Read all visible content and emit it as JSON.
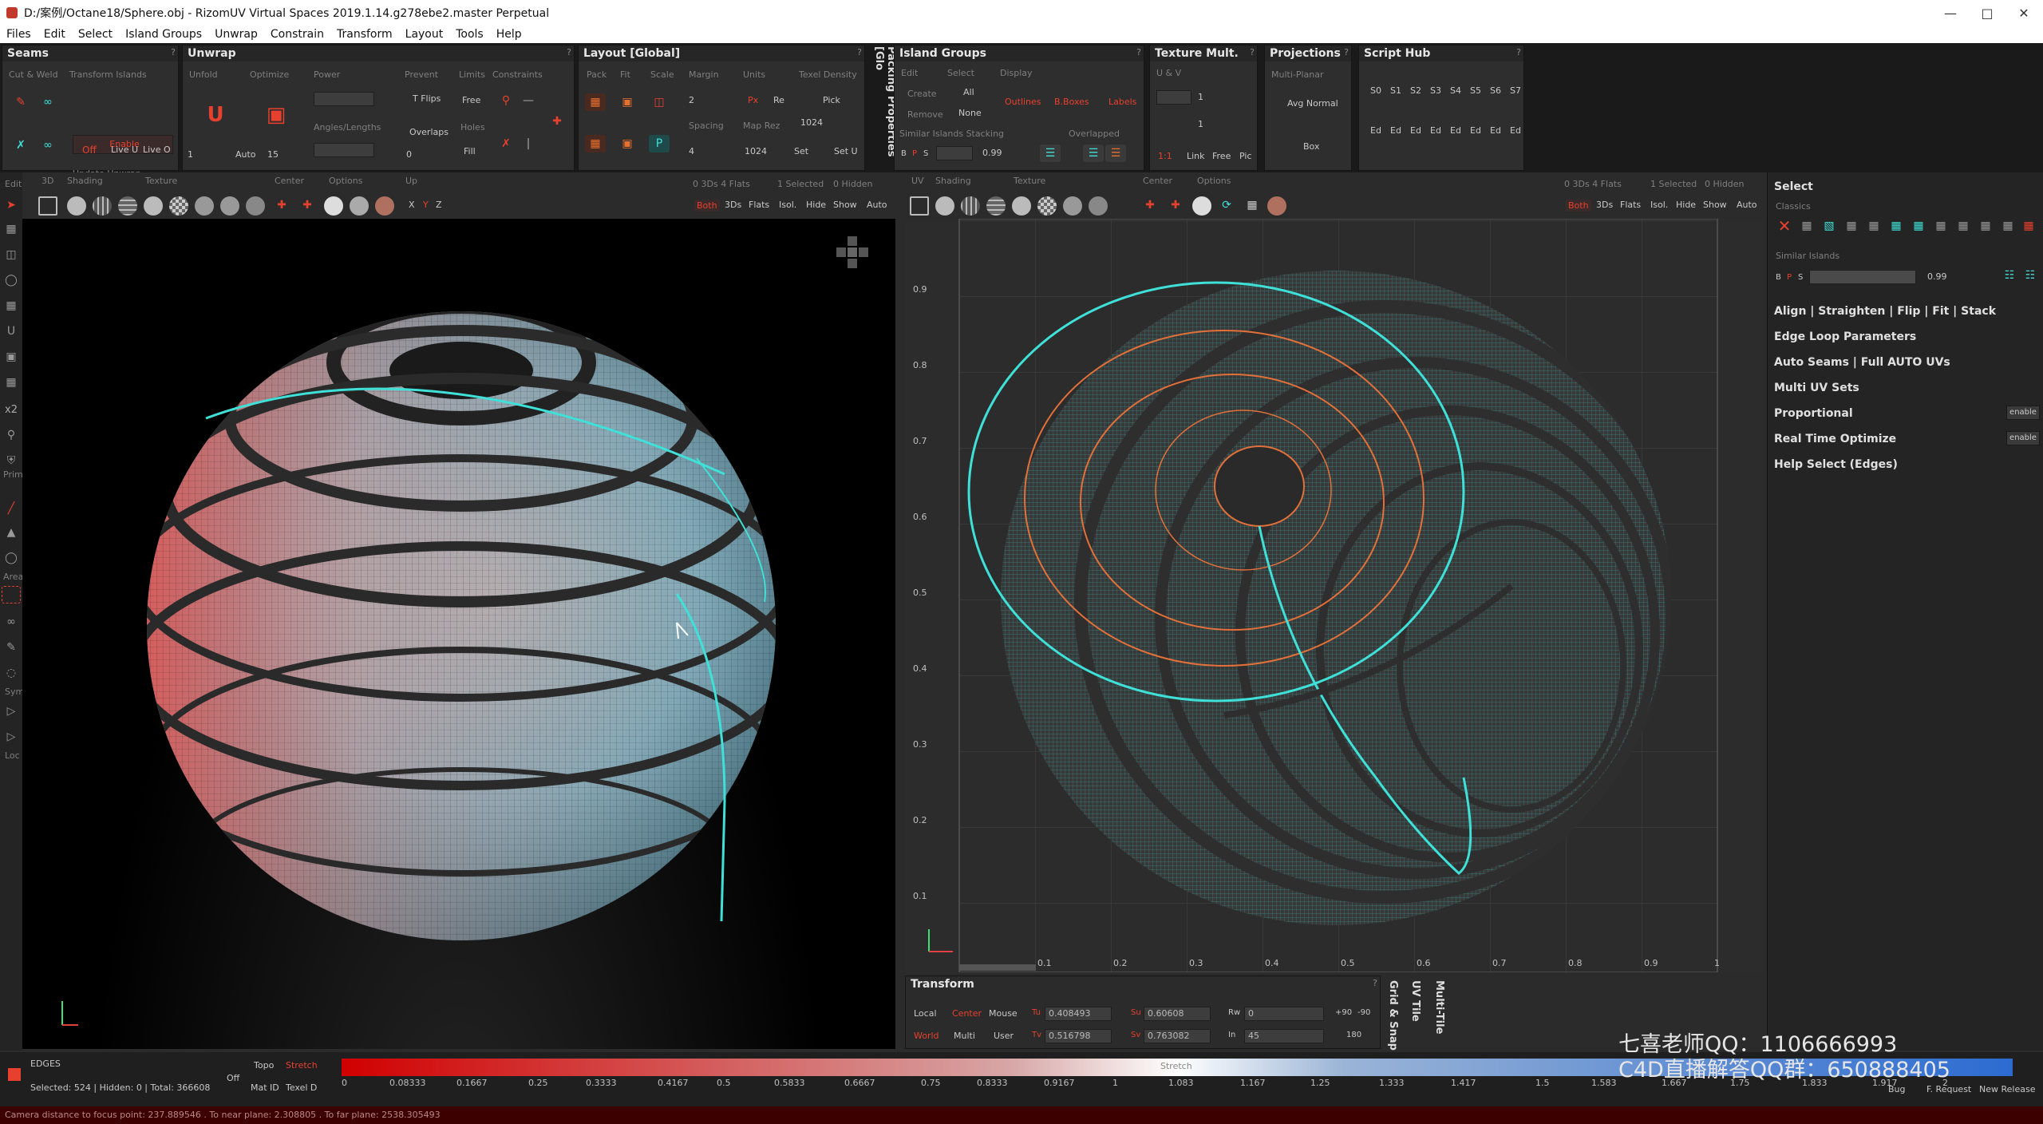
{
  "window": {
    "title": "D:/案例/Octane18/Sphere.obj - RizomUV  Virtual Spaces 2019.1.14.g278ebe2.master Perpetual"
  },
  "menu": [
    "Files",
    "Edit",
    "Select",
    "Island Groups",
    "Unwrap",
    "Constrain",
    "Transform",
    "Layout",
    "Tools",
    "Help"
  ],
  "seams": {
    "title": "Seams",
    "cut_weld": "Cut & Weld",
    "transform_islands": "Transform Islands",
    "enable": "Enable",
    "update_unwrap": "Update Unwrap",
    "off": "Off",
    "live_u": "Live U",
    "live_o": "Live O"
  },
  "unwrap": {
    "title": "Unwrap",
    "unfold": "Unfold",
    "optimize": "Optimize",
    "power": "Power",
    "prevent": "Prevent",
    "limits": "Limits",
    "constraints": "Constraints",
    "t_flips": "T Flips",
    "free": "Free",
    "angles_lengths": "Angles/Lengths",
    "overlaps": "Overlaps",
    "holes": "Holes",
    "fill": "Fill",
    "val1": "1",
    "auto": "Auto",
    "val15": "15",
    "val0": "0"
  },
  "layout": {
    "title": "Layout [Global]",
    "pack": "Pack",
    "fit": "Fit",
    "scale": "Scale",
    "margin": "Margin",
    "units": "Units",
    "texel_density": "Texel Density",
    "margin_val": "2",
    "px": "Px",
    "re": "Re",
    "pick": "Pick",
    "spacing": "Spacing",
    "map_rez": "Map Rez",
    "spacing_val": "4",
    "map_rez_val1": "1024",
    "map_rez_val2": "1024",
    "set": "Set",
    "set_u": "Set U",
    "packing_tab": "Packing Properties [Glo"
  },
  "island_groups": {
    "title": "Island Groups",
    "edit": "Edit",
    "select": "Select",
    "display": "Display",
    "create": "Create",
    "all": "All",
    "remove": "Remove",
    "none": "None",
    "outlines": "Outlines",
    "bboxes": "B.Boxes",
    "labels": "Labels",
    "similar_stacking": "Similar Islands Stacking",
    "overlapped": "Overlapped",
    "b": "B",
    "p": "P",
    "s": "S",
    "sim_val": "0.99"
  },
  "texture_mult": {
    "title": "Texture Mult.",
    "uv": "U & V",
    "v1": "1",
    "v2": "1",
    "ratio": "1:1",
    "link": "Link",
    "free": "Free",
    "pic": "Pic"
  },
  "projections": {
    "title": "Projections",
    "multi_planar": "Multi-Planar",
    "avg_normal": "Avg Normal",
    "box": "Box"
  },
  "script_hub": {
    "title": "Script Hub",
    "slots": [
      "S0",
      "S1",
      "S2",
      "S3",
      "S4",
      "S5",
      "S6",
      "S7"
    ],
    "ed": [
      "Ed",
      "Ed",
      "Ed",
      "Ed",
      "Ed",
      "Ed",
      "Ed",
      "Ed"
    ]
  },
  "vp3d": {
    "edit": "Edit",
    "label_3d": "3D",
    "shading": "Shading",
    "texture": "Texture",
    "center": "Center",
    "options": "Options",
    "up": "Up",
    "x": "X",
    "y": "Y",
    "z": "Z",
    "stats_flats": "0 3Ds 4 Flats",
    "stats_sel": "1 Selected",
    "stats_hidden": "0 Hidden",
    "both": "Both",
    "threeds": "3Ds",
    "flats": "Flats",
    "isol": "Isol.",
    "hide": "Hide",
    "show": "Show",
    "auto": "Auto"
  },
  "vpuv": {
    "uv": "UV",
    "shading": "Shading",
    "texture": "Texture",
    "center": "Center",
    "options": "Options",
    "stats_flats": "0 3Ds 4 Flats",
    "stats_sel": "1 Selected",
    "stats_hidden": "0 Hidden",
    "both": "Both",
    "threeds": "3Ds",
    "flats": "Flats",
    "isol": "Isol.",
    "hide": "Hide",
    "show": "Show",
    "auto": "Auto",
    "yticks": [
      "0.9",
      "0.8",
      "0.7",
      "0.6",
      "0.5",
      "0.4",
      "0.3",
      "0.2",
      "0.1"
    ],
    "xticks": [
      "0.1",
      "0.2",
      "0.3",
      "0.4",
      "0.5",
      "0.6",
      "0.7",
      "0.8",
      "0.9",
      "1"
    ]
  },
  "sidetools": {
    "x2": "x2",
    "prim": "Prim",
    "area": "Area",
    "sym": "Sym",
    "loc": "Loc"
  },
  "select_panel": {
    "title": "Select",
    "classics": "Classics",
    "similar_islands": "Similar Islands",
    "b": "B",
    "p": "P",
    "s": "S",
    "sim_val": "0.99",
    "sections": [
      "Align | Straighten | Flip | Fit | Stack",
      "Edge Loop Parameters",
      "Auto Seams | Full AUTO UVs",
      "Multi UV Sets",
      "Proportional",
      "Real Time Optimize",
      "Help Select (Edges)"
    ],
    "enable": "enable"
  },
  "transform": {
    "title": "Transform",
    "local": "Local",
    "center": "Center",
    "mouse": "Mouse",
    "world": "World",
    "multi": "Multi",
    "user": "User",
    "tu": "Tu",
    "tu_val": "0.408493",
    "tv": "Tv",
    "tv_val": "0.516798",
    "su": "Su",
    "su_val": "0.60608",
    "sv": "Sv",
    "sv_val": "0.763082",
    "rw": "Rw",
    "rw_val": "0",
    "in": "In",
    "in_val": "45",
    "p90": "+90",
    "m90": "-90",
    "d180": "180",
    "grid_snap": "Grid & Snap",
    "uv_tile": "UV Tile",
    "multi_tile": "Multi-Tile"
  },
  "bottom": {
    "edges": "EDGES",
    "selected": "Selected: 524 | Hidden: 0 | Total: 366608",
    "off": "Off",
    "topo": "Topo",
    "stretch": "Stretch",
    "mat_id": "Mat ID",
    "texel_d": "Texel D",
    "stretch_center": "Stretch",
    "ticks": [
      "0",
      "0.08333",
      "0.1667",
      "0.25",
      "0.3333",
      "0.4167",
      "0.5",
      "0.5833",
      "0.6667",
      "0.75",
      "0.8333",
      "0.9167",
      "1",
      "1.083",
      "1.167",
      "1.25",
      "1.333",
      "1.417",
      "1.5",
      "1.583",
      "1.667",
      "1.75",
      "1.833",
      "1.917",
      "2"
    ],
    "bug": "Bug",
    "feature_request": "F. Request",
    "new_release": "New Release"
  },
  "watermark": {
    "line1": "七喜老师QQ：1106666993",
    "line2": "C4D直播解答QQ群：650888405"
  },
  "status": "Camera distance to focus point: 237.889546 . To near plane: 2.308805 . To far plane: 2538.305493",
  "colors": {
    "accent_red": "#e8402e",
    "cyan": "#3fe0d8",
    "orange": "#e2703a"
  }
}
